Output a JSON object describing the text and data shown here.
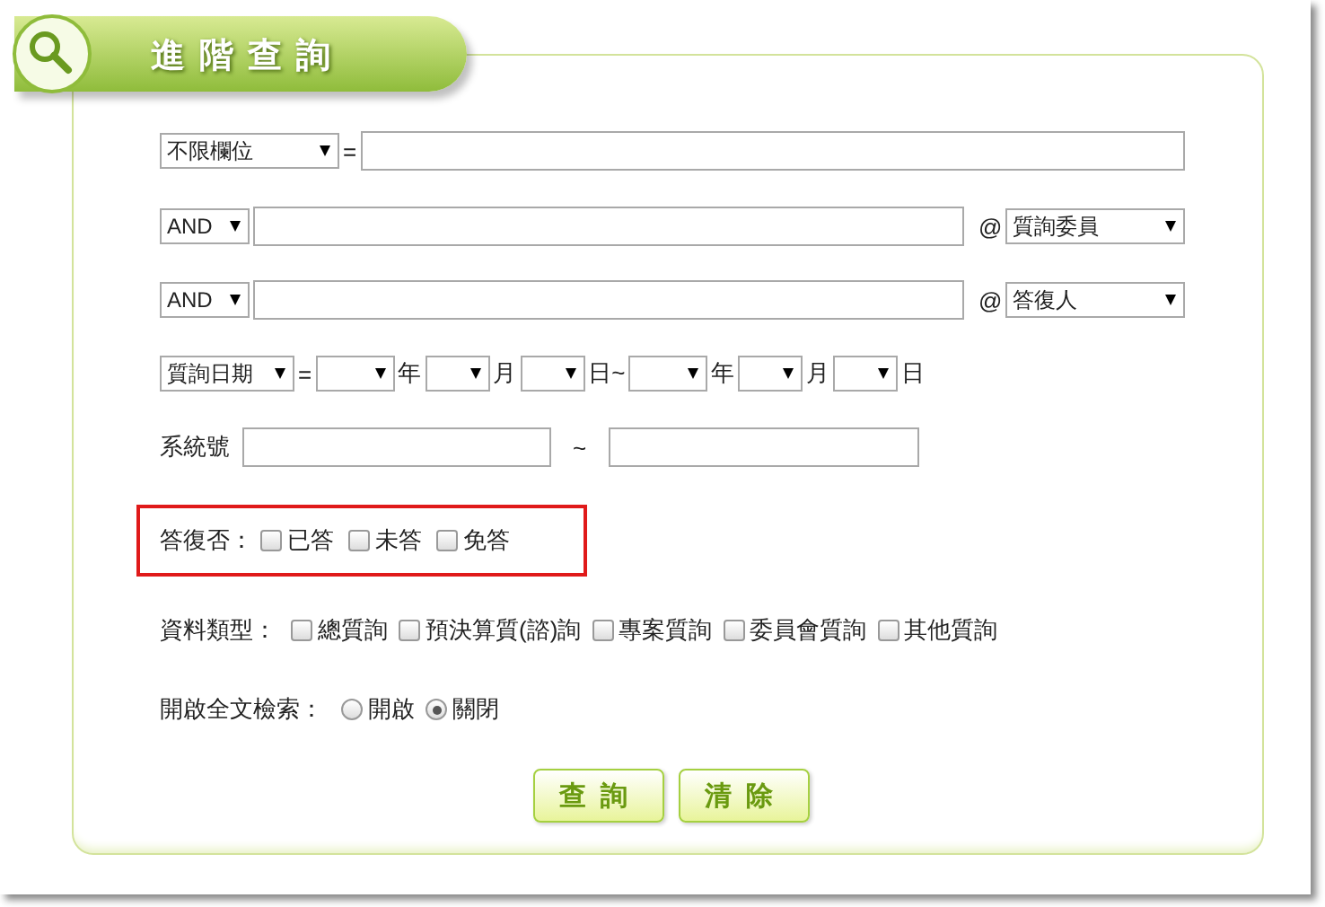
{
  "header": {
    "title": "進階查詢"
  },
  "field_row": {
    "field": "不限欄位",
    "operator": "="
  },
  "keyword_rows": [
    {
      "operator": "AND",
      "at": "@",
      "field": "質詢委員"
    },
    {
      "operator": "AND",
      "at": "@",
      "field": "答復人"
    }
  ],
  "date_row": {
    "field": "質詢日期",
    "operator": "=",
    "units": [
      "年",
      "月",
      "日~",
      "年",
      "月",
      "日"
    ]
  },
  "serial_row": {
    "label": "系統號",
    "separator": "~"
  },
  "reply_status": {
    "label": "答復否：",
    "options": [
      {
        "label": "已答",
        "checked": false
      },
      {
        "label": "未答",
        "checked": false
      },
      {
        "label": "免答",
        "checked": false
      }
    ]
  },
  "data_type": {
    "label": "資料類型：",
    "options": [
      {
        "label": "總質詢",
        "checked": false
      },
      {
        "label": "預決算質(諮)詢",
        "checked": false
      },
      {
        "label": "專案質詢",
        "checked": false
      },
      {
        "label": "委員會質詢",
        "checked": false
      },
      {
        "label": "其他質詢",
        "checked": false
      }
    ]
  },
  "fulltext": {
    "label": "開啟全文檢索：",
    "options": [
      {
        "label": "開啟",
        "selected": false
      },
      {
        "label": "關閉",
        "selected": true
      }
    ]
  },
  "buttons": [
    "查詢",
    "清除"
  ]
}
